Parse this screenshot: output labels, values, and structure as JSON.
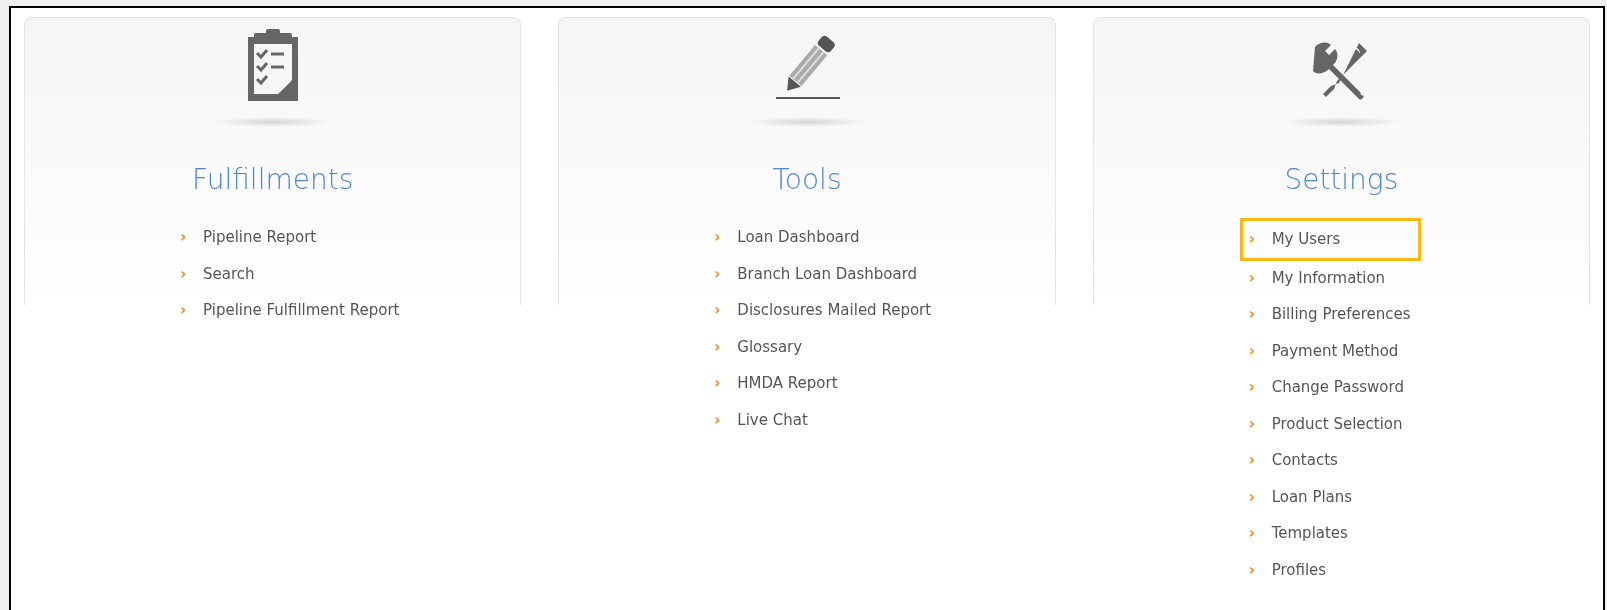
{
  "panels": [
    {
      "kind": "clipboard",
      "title": "Fulfillments",
      "items": [
        {
          "bullet": "›",
          "label": "Pipeline Report",
          "highlighted": false
        },
        {
          "bullet": "›",
          "label": "Search",
          "highlighted": false
        },
        {
          "bullet": "›",
          "label": "Pipeline Fulfillment Report",
          "highlighted": false
        }
      ]
    },
    {
      "kind": "pencil",
      "title": "Tools",
      "items": [
        {
          "bullet": "›",
          "label": "Loan Dashboard",
          "highlighted": false
        },
        {
          "bullet": "›",
          "label": "Branch Loan Dashboard",
          "highlighted": false
        },
        {
          "bullet": "›",
          "label": "Disclosures Mailed Report",
          "highlighted": false
        },
        {
          "bullet": "›",
          "label": "Glossary",
          "highlighted": false
        },
        {
          "bullet": "›",
          "label": "HMDA Report",
          "highlighted": false
        },
        {
          "bullet": "›",
          "label": "Live Chat",
          "highlighted": false
        }
      ]
    },
    {
      "kind": "tools",
      "title": "Settings",
      "items": [
        {
          "bullet": "›",
          "label": "My Users",
          "highlighted": true
        },
        {
          "bullet": "›",
          "label": "My Information",
          "highlighted": false
        },
        {
          "bullet": "›",
          "label": "Billing Preferences",
          "highlighted": false
        },
        {
          "bullet": "›",
          "label": "Payment Method",
          "highlighted": false
        },
        {
          "bullet": "›",
          "label": "Change Password",
          "highlighted": false
        },
        {
          "bullet": "›",
          "label": "Product Selection",
          "highlighted": false
        },
        {
          "bullet": "›",
          "label": "Contacts",
          "highlighted": false
        },
        {
          "bullet": "›",
          "label": "Loan Plans",
          "highlighted": false
        },
        {
          "bullet": "›",
          "label": "Templates",
          "highlighted": false
        },
        {
          "bullet": "›",
          "label": "Profiles",
          "highlighted": false
        }
      ]
    }
  ]
}
